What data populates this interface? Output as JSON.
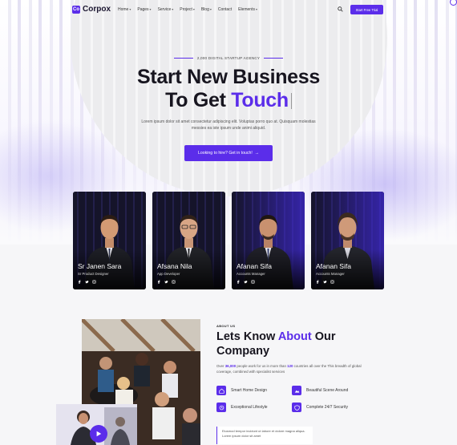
{
  "nav": {
    "logo_mark": "Co",
    "logo_text": "Corpox",
    "items": [
      {
        "label": "Home",
        "caret": "▾"
      },
      {
        "label": "Pages",
        "caret": "▾"
      },
      {
        "label": "Service",
        "caret": "▾"
      },
      {
        "label": "Project",
        "caret": "▾"
      },
      {
        "label": "Blog",
        "caret": "▾"
      },
      {
        "label": "Contact",
        "caret": ""
      },
      {
        "label": "Elements",
        "caret": "▾"
      }
    ],
    "cta_label": "Start Free Trial"
  },
  "hero": {
    "tagline": "2,000 DIGITAL STARTUP AGENCY",
    "title_line1": "Start New Business",
    "title_line2_prefix": "To Get ",
    "title_line2_accent": "Touch",
    "subtitle": "Lorem ipsum dolor sit amet consectetur adipiscing elit. Voluptas porro quo at. Quisquam molestias messies ea iste ipsum unde animi aliquid.",
    "cta_label": "Looking to hire? Get in touch!",
    "cta_arrow": "→"
  },
  "team": [
    {
      "name": "Sr Janen Sara",
      "role": "Sr Product Designer"
    },
    {
      "name": "Afsana Nila",
      "role": "App Developer"
    },
    {
      "name": "Afanan Sifa",
      "role": "Accounts Manager"
    },
    {
      "name": "Afanan Sifa",
      "role": "Accounts Manager"
    }
  ],
  "about": {
    "tag": "ABOUT US",
    "title_prefix": "Lets Know ",
    "title_accent": "About",
    "title_suffix": " Our",
    "title_line2": "Company",
    "para_prefix": "Over ",
    "para_num1": "36,000",
    "para_mid": " people work for us in more than ",
    "para_num2": "120",
    "para_suffix": " countries all over the This breadth of global coverage, combined with specialist services",
    "features": [
      {
        "label": "Smart Home Design",
        "icon": "home-icon"
      },
      {
        "label": "Beautiful Scene Around",
        "icon": "scene-icon"
      },
      {
        "label": "Exceptional Lifestyle",
        "icon": "lifestyle-icon"
      },
      {
        "label": "Complete 24/7 Security",
        "icon": "shield-icon"
      }
    ],
    "quote": "Eiusmod tempor incidunt ut labore et dolore magna aliqua. Lorem ipsum dolor sit amet"
  },
  "colors": {
    "accent": "#5b2dea",
    "text": "#17151f",
    "background": "#f6f6f8"
  }
}
